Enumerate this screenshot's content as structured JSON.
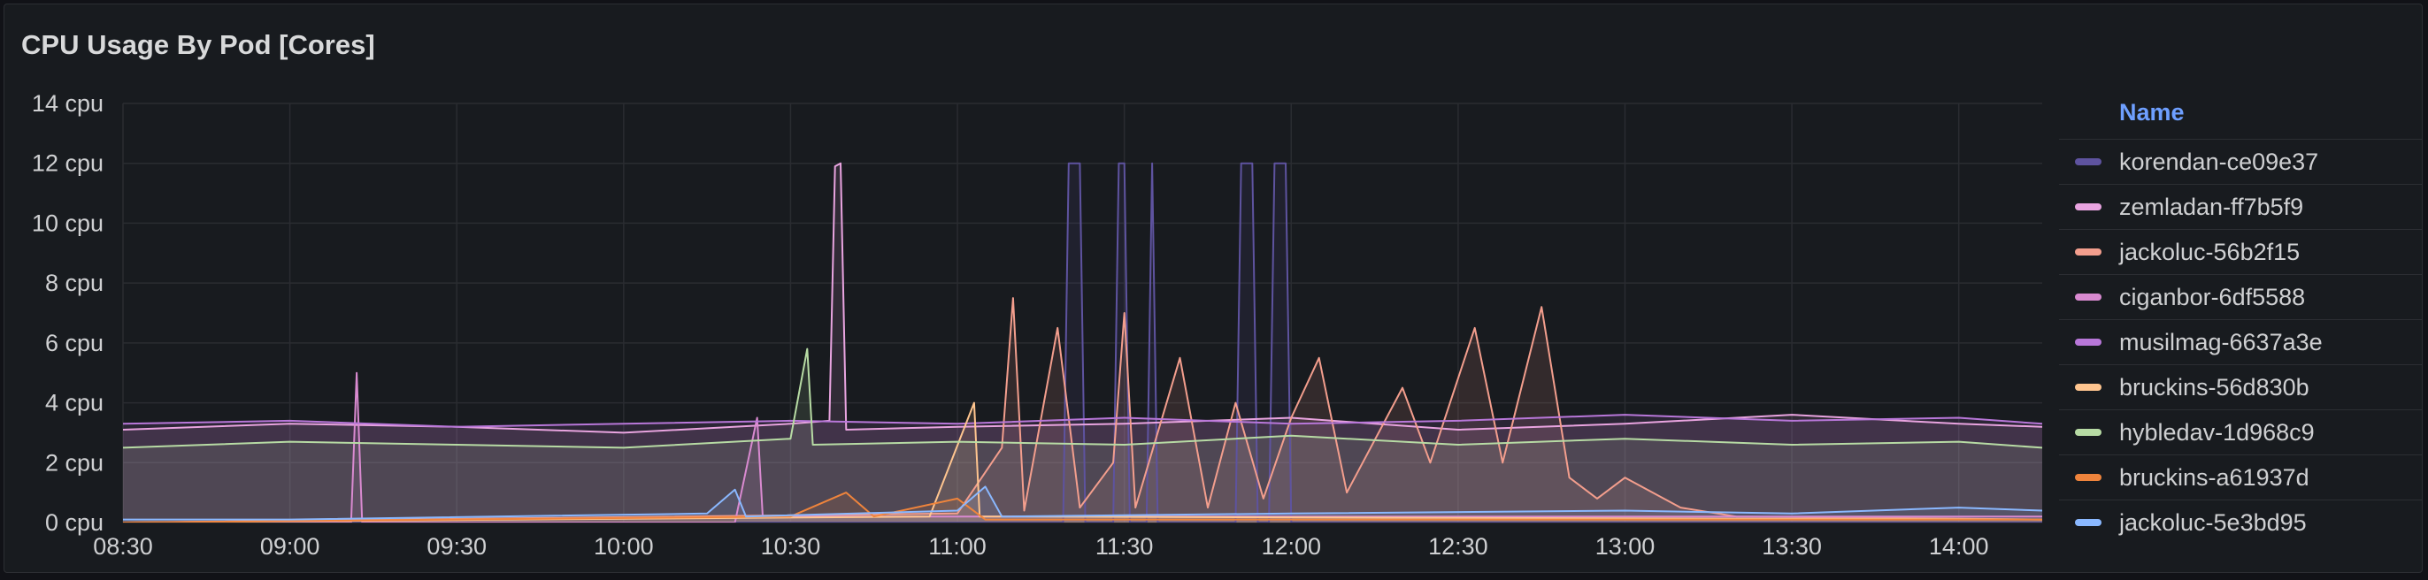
{
  "panel": {
    "title": "CPU Usage By Pod [Cores]"
  },
  "legend": {
    "header": "Name"
  },
  "chart_data": {
    "type": "line",
    "title": "CPU Usage By Pod [Cores]",
    "y_unit": "cpu",
    "ylim": [
      0,
      14
    ],
    "y_ticks": [
      "0 cpu",
      "2 cpu",
      "4 cpu",
      "6 cpu",
      "8 cpu",
      "10 cpu",
      "12 cpu",
      "14 cpu"
    ],
    "xlim": [
      "08:30",
      "14:15"
    ],
    "x_ticks": [
      "08:30",
      "09:00",
      "09:30",
      "10:00",
      "10:30",
      "11:00",
      "11:30",
      "12:00",
      "12:30",
      "13:00",
      "13:30",
      "14:00"
    ],
    "grid": true,
    "legend_position": "right",
    "series": [
      {
        "name": "korendan-ce09e37",
        "color": "#5e539f",
        "points": [
          [
            "08:30",
            0
          ],
          [
            "11:19",
            0
          ],
          [
            "11:20",
            12
          ],
          [
            "11:22",
            12
          ],
          [
            "11:23",
            0
          ],
          [
            "11:28",
            0
          ],
          [
            "11:29",
            12
          ],
          [
            "11:30",
            12
          ],
          [
            "11:31",
            0
          ],
          [
            "11:34",
            0
          ],
          [
            "11:35",
            12
          ],
          [
            "11:36",
            0
          ],
          [
            "11:50",
            0
          ],
          [
            "11:51",
            12
          ],
          [
            "11:53",
            12
          ],
          [
            "11:54",
            0
          ],
          [
            "11:56",
            0
          ],
          [
            "11:57",
            12
          ],
          [
            "11:59",
            12
          ],
          [
            "12:00",
            0
          ],
          [
            "14:15",
            0
          ]
        ]
      },
      {
        "name": "zemladan-ff7b5f9",
        "color": "#e9a4e0",
        "points": [
          [
            "08:30",
            3.1
          ],
          [
            "09:00",
            3.3
          ],
          [
            "09:30",
            3.2
          ],
          [
            "10:00",
            3.0
          ],
          [
            "10:30",
            3.3
          ],
          [
            "10:37",
            3.4
          ],
          [
            "10:38",
            11.9
          ],
          [
            "10:39",
            12
          ],
          [
            "10:40",
            3.1
          ],
          [
            "11:00",
            3.2
          ],
          [
            "11:30",
            3.3
          ],
          [
            "12:00",
            3.5
          ],
          [
            "12:30",
            3.1
          ],
          [
            "13:00",
            3.3
          ],
          [
            "13:30",
            3.6
          ],
          [
            "14:00",
            3.3
          ],
          [
            "14:15",
            3.2
          ]
        ]
      },
      {
        "name": "jackoluc-56b2f15",
        "color": "#f39e8d",
        "points": [
          [
            "08:30",
            0
          ],
          [
            "11:00",
            0.3
          ],
          [
            "11:08",
            2.5
          ],
          [
            "11:10",
            7.5
          ],
          [
            "11:12",
            0.4
          ],
          [
            "11:18",
            6.5
          ],
          [
            "11:22",
            0.5
          ],
          [
            "11:28",
            2
          ],
          [
            "11:30",
            7
          ],
          [
            "11:32",
            0.5
          ],
          [
            "11:40",
            5.5
          ],
          [
            "11:45",
            0.5
          ],
          [
            "11:50",
            4.0
          ],
          [
            "11:55",
            0.8
          ],
          [
            "12:00",
            3.5
          ],
          [
            "12:05",
            5.5
          ],
          [
            "12:10",
            1
          ],
          [
            "12:20",
            4.5
          ],
          [
            "12:25",
            2
          ],
          [
            "12:33",
            6.5
          ],
          [
            "12:38",
            2
          ],
          [
            "12:45",
            7.2
          ],
          [
            "12:50",
            1.5
          ],
          [
            "12:55",
            0.8
          ],
          [
            "13:00",
            1.5
          ],
          [
            "13:10",
            0.5
          ],
          [
            "13:20",
            0.2
          ],
          [
            "14:15",
            0.1
          ]
        ]
      },
      {
        "name": "ciganbor-6df5588",
        "color": "#d98ad0",
        "points": [
          [
            "08:30",
            0
          ],
          [
            "09:11",
            0
          ],
          [
            "09:12",
            5.0
          ],
          [
            "09:13",
            0
          ],
          [
            "10:20",
            0
          ],
          [
            "10:24",
            3.5
          ],
          [
            "10:25",
            0.2
          ],
          [
            "14:15",
            0.2
          ]
        ]
      },
      {
        "name": "musilmag-6637a3e",
        "color": "#b877d9",
        "points": [
          [
            "08:30",
            3.3
          ],
          [
            "09:00",
            3.4
          ],
          [
            "09:30",
            3.2
          ],
          [
            "10:00",
            3.3
          ],
          [
            "10:30",
            3.4
          ],
          [
            "11:00",
            3.3
          ],
          [
            "11:30",
            3.5
          ],
          [
            "12:00",
            3.3
          ],
          [
            "12:30",
            3.4
          ],
          [
            "13:00",
            3.6
          ],
          [
            "13:30",
            3.4
          ],
          [
            "14:00",
            3.5
          ],
          [
            "14:15",
            3.3
          ]
        ]
      },
      {
        "name": "bruckins-56d830b",
        "color": "#ffc58f",
        "points": [
          [
            "08:30",
            0
          ],
          [
            "10:55",
            0.2
          ],
          [
            "11:03",
            4.0
          ],
          [
            "11:04",
            0.2
          ],
          [
            "14:15",
            0.1
          ]
        ]
      },
      {
        "name": "hybledav-1d968c9",
        "color": "#b7dba4",
        "points": [
          [
            "08:30",
            2.5
          ],
          [
            "09:00",
            2.7
          ],
          [
            "09:30",
            2.6
          ],
          [
            "10:00",
            2.5
          ],
          [
            "10:30",
            2.8
          ],
          [
            "10:33",
            5.8
          ],
          [
            "10:34",
            2.6
          ],
          [
            "11:00",
            2.7
          ],
          [
            "11:30",
            2.6
          ],
          [
            "12:00",
            2.9
          ],
          [
            "12:30",
            2.6
          ],
          [
            "13:00",
            2.8
          ],
          [
            "13:30",
            2.6
          ],
          [
            "14:00",
            2.7
          ],
          [
            "14:15",
            2.5
          ]
        ]
      },
      {
        "name": "bruckins-a61937d",
        "color": "#ef843c",
        "points": [
          [
            "08:30",
            0
          ],
          [
            "10:30",
            0.2
          ],
          [
            "10:40",
            1.0
          ],
          [
            "10:45",
            0.2
          ],
          [
            "11:00",
            0.8
          ],
          [
            "11:05",
            0.1
          ],
          [
            "14:15",
            0.1
          ]
        ]
      },
      {
        "name": "jackoluc-5e3bd95",
        "color": "#8ab8ff",
        "points": [
          [
            "08:30",
            0.1
          ],
          [
            "09:00",
            0.1
          ],
          [
            "10:15",
            0.3
          ],
          [
            "10:20",
            1.1
          ],
          [
            "10:22",
            0.2
          ],
          [
            "11:00",
            0.4
          ],
          [
            "11:05",
            1.2
          ],
          [
            "11:08",
            0.2
          ],
          [
            "12:00",
            0.3
          ],
          [
            "13:00",
            0.4
          ],
          [
            "13:30",
            0.3
          ],
          [
            "14:00",
            0.5
          ],
          [
            "14:15",
            0.4
          ]
        ]
      }
    ]
  }
}
